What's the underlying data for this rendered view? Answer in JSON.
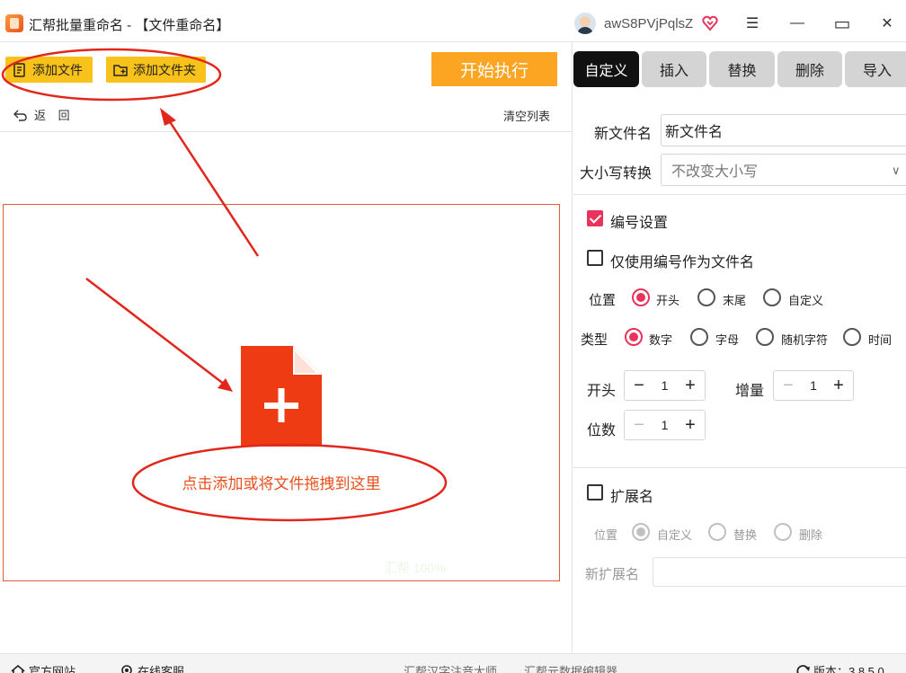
{
  "titlebar": {
    "title": "汇帮批量重命名 - 【文件重命名】",
    "username": "awS8PVjPqlsZ",
    "menu_icon": "☰",
    "minimize_icon": "—",
    "maximize_icon": "▭",
    "close_icon": "✕"
  },
  "toolbar": {
    "add_file": "添加文件",
    "add_folder": "添加文件夹",
    "start": "开始执行",
    "back": "返 回",
    "clear_list": "清空列表"
  },
  "drop": {
    "hint": "点击添加或将文件拖拽到这里",
    "faint_watermark": "汇帮 100%"
  },
  "tabs": [
    {
      "label": "自定义",
      "active": true
    },
    {
      "label": "插入",
      "active": false
    },
    {
      "label": "替换",
      "active": false
    },
    {
      "label": "删除",
      "active": false
    },
    {
      "label": "导入",
      "active": false
    }
  ],
  "settings": {
    "new_name_label": "新文件名",
    "new_name_value": "新文件名",
    "case_label": "大小写转换",
    "case_value": "不改变大小写",
    "numbering_label": "编号设置",
    "numbering_checked": true,
    "only_number_label": "仅使用编号作为文件名",
    "only_number_checked": false,
    "position_label": "位置",
    "position_options": [
      "开头",
      "末尾",
      "自定义"
    ],
    "position_selected": "开头",
    "type_label": "类型",
    "type_options": [
      "数字",
      "字母",
      "随机字符",
      "时间"
    ],
    "type_selected": "数字",
    "start_label": "开头",
    "start_value": "1",
    "increment_label": "增量",
    "increment_value": "1",
    "digits_label": "位数",
    "digits_value": "1",
    "extension_label": "扩展名",
    "extension_checked": false,
    "ext_position_label": "位置",
    "ext_position_options": [
      "自定义",
      "替换",
      "删除"
    ],
    "ext_position_selected": "自定义",
    "new_ext_label": "新扩展名",
    "new_ext_value": ""
  },
  "statusbar": {
    "website": "官方网站",
    "support": "在线客服",
    "link1": "汇帮汉字注音大师",
    "link2": "汇帮元数据编辑器",
    "version": "版本：3.8.5.0"
  },
  "colors": {
    "accent": "#e8335a",
    "yellow_button": "#f9c21a",
    "start_button": "#fca522",
    "drop_border": "#e25d3a",
    "annotation_red": "#e3261c"
  }
}
